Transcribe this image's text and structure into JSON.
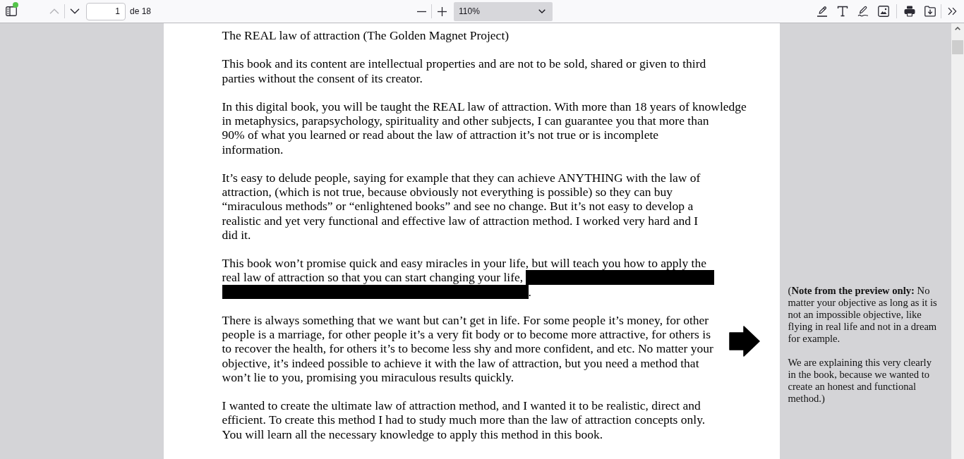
{
  "toolbar": {
    "sidebar_toggle": {
      "notification": true
    },
    "previous_page": {
      "disabled": true
    },
    "next_page": {
      "disabled": false
    },
    "page_number": "1",
    "page_count": "de 18",
    "zoom": "110%"
  },
  "document": {
    "title": "The REAL law of attraction (The Golden Magnet Project)",
    "paragraphs": [
      {
        "text": "This book and its content are intellectual properties and are not to be sold, shared or given to third\nparties without the consent of its creator.",
        "redacted": false
      },
      {
        "text": "In this digital book, you will be taught the REAL law of attraction. With more than 18 years of knowledge\nin metaphysics, parapsychology, spirituality and other subjects, I can guarantee you that more than\n90% of what you learned or read about the law of attraction it’s not true or is incomplete\ninformation.",
        "redacted": false
      },
      {
        "text": "It’s easy to delude people, saying for example that they can achieve ANYTHING with the law of\nattraction, (which is not true, because obviously not everything is possible) so they can buy\n“miraculous methods” or “enlightened books” and see no change. But it’s not easy to develop a\nrealistic and yet very functional and effective law of attraction method. I worked very hard and I\ndid it.",
        "redacted": false
      },
      {
        "lines": [
          "This book won’t promise quick and easy miracles in your life, but will teach you how to apply the",
          "real law of attraction so that you can start changing your life,"
        ],
        "redacted": true,
        "ending": "."
      },
      {
        "text": "There is always something that we want but can’t get in life. For some people it’s money, for other\npeople is a marriage, for other people it’s a very fit body or to become more attractive, for others is\nto recover the health, for others it’s to become less shy and more confident, and etc. No matter your\nobjective, it’s indeed possible to achieve it with the law of attraction, but you need a method that\nwon’t lie to you, promising you miraculous results quickly.",
        "redacted": false
      },
      {
        "text": "I wanted to create the ultimate law of attraction method, and I wanted it to be realistic, direct and\nefficient. To create this method I had to study much more than the law of attraction concepts only.\nYou will learn all the necessary knowledge to apply this method in this book.",
        "redacted": false
      }
    ]
  },
  "note": {
    "paragraphs": [
      "(**Note from the preview only:** No\nmatter your objective as long as it is\nnot an impossible objective, like\nflying in real life and not in a dream\nfor example.",
      "We are explaining this very clearly\nin the book, because we wanted to\ncreate an honest and functional\nmethod.)"
    ]
  }
}
